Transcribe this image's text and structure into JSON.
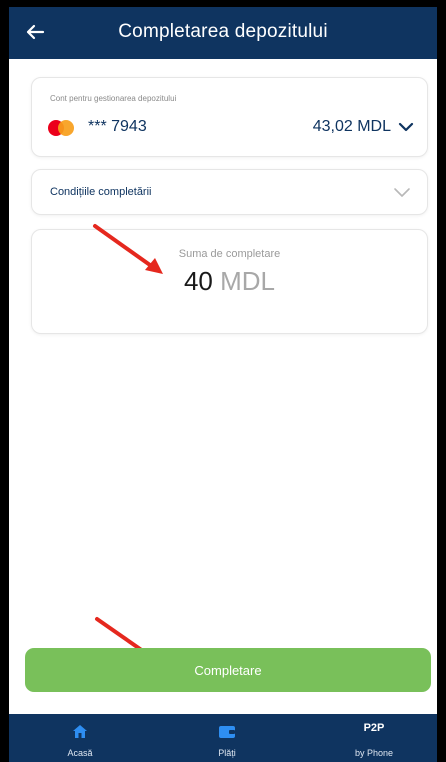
{
  "header": {
    "title": "Completarea depozitului",
    "back_icon": "arrow-left-icon"
  },
  "account": {
    "label": "Cont pentru gestionarea depozitului",
    "masked_number": "*** 7943",
    "balance": "43,02 MDL",
    "card_brand_icon": "mastercard-icon"
  },
  "conditions": {
    "label": "Condițiile completării"
  },
  "amount": {
    "label": "Suma de completare",
    "value": "40",
    "currency": "MDL"
  },
  "action": {
    "submit_label": "Completare",
    "color": "#79c05a"
  },
  "bottom_nav": {
    "items": [
      {
        "label": "Acasă",
        "icon": "home-icon"
      },
      {
        "label": "Plăți",
        "icon": "wallet-icon"
      },
      {
        "top": "P2P",
        "label": "by Phone",
        "icon": "p2p-text"
      }
    ]
  },
  "colors": {
    "primary": "#0f3460",
    "annotation_arrow": "#e5281e"
  }
}
